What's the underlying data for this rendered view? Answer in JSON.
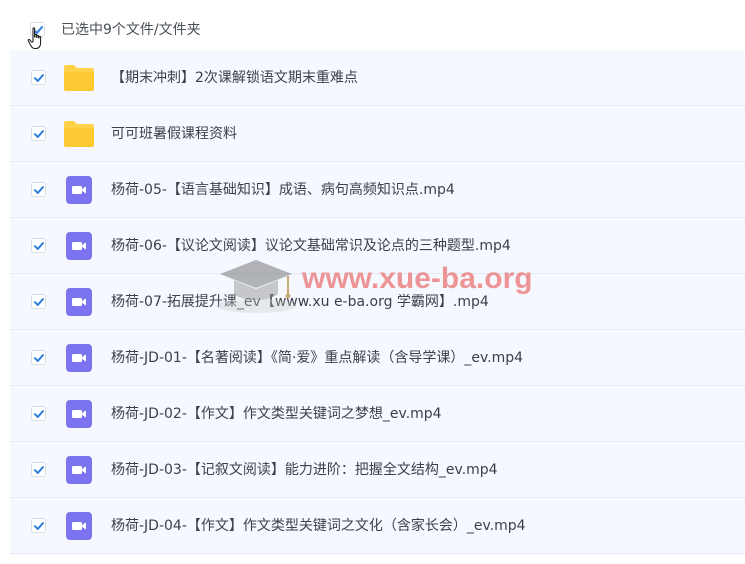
{
  "header": {
    "selected_text": "已选中9个文件/文件夹"
  },
  "items": [
    {
      "type": "folder",
      "name": "【期末冲刺】2次课解锁语文期末重难点"
    },
    {
      "type": "folder",
      "name": "可可班暑假课程资料"
    },
    {
      "type": "video",
      "name": "杨荷-05-【语言基础知识】成语、病句高频知识点.mp4"
    },
    {
      "type": "video",
      "name": "杨荷-06-【议论文阅读】议论文基础常识及论点的三种题型.mp4"
    },
    {
      "type": "video",
      "name": "杨荷-07-拓展提升课_ev【www.xu e-ba.org 学霸网】.mp4"
    },
    {
      "type": "video",
      "name": "杨荷-JD-01-【名著阅读】《简·爱》重点解读（含导学课）_ev.mp4"
    },
    {
      "type": "video",
      "name": "杨荷-JD-02-【作文】作文类型关键词之梦想_ev.mp4"
    },
    {
      "type": "video",
      "name": "杨荷-JD-03-【记叙文阅读】能力进阶：把握全文结构_ev.mp4"
    },
    {
      "type": "video",
      "name": "杨荷-JD-04-【作文】作文类型关键词之文化（含家长会）_ev.mp4"
    }
  ],
  "watermark": {
    "text": "www.xue-ba.org"
  },
  "colors": {
    "check": "#2a7de1",
    "folder": "#ffd24a",
    "video": "#7b73f0",
    "row_bg": "#f5f9ff"
  }
}
